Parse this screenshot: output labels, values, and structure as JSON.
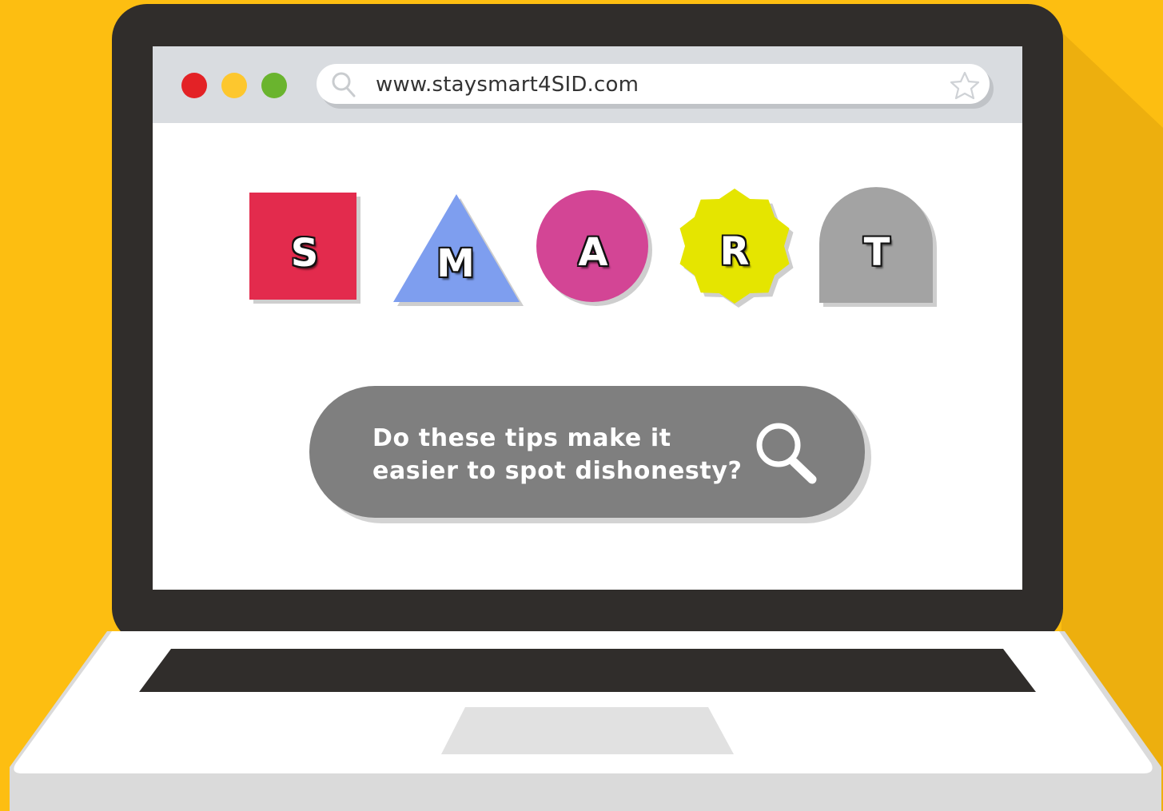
{
  "browser": {
    "url": "www.staysmart4SID.com",
    "traffic_lights": [
      "#E32226",
      "#FDC72E",
      "#6AB42E"
    ]
  },
  "smart_tiles": [
    {
      "letter": "S",
      "shape": "square",
      "color": "#E32B4D"
    },
    {
      "letter": "M",
      "shape": "triangle",
      "color": "#7E9EEF"
    },
    {
      "letter": "A",
      "shape": "circle",
      "color": "#D34595"
    },
    {
      "letter": "R",
      "shape": "star-burst",
      "color": "#E5E500"
    },
    {
      "letter": "T",
      "shape": "arch",
      "color": "#A3A3A3"
    }
  ],
  "search": {
    "query_line1": "Do these tips make it",
    "query_line2": "easier to spot dishonesty?"
  },
  "colors": {
    "background": "#FDBE11",
    "laptop_frame": "#302D2B",
    "screen": "#FFFFFF"
  }
}
